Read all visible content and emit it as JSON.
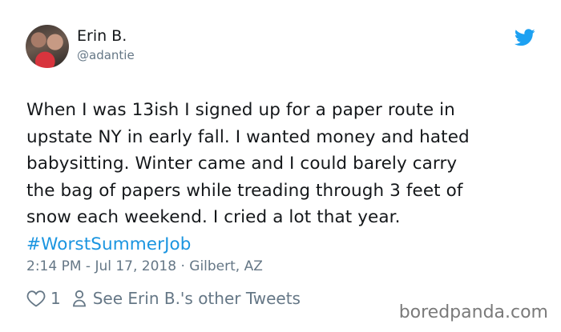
{
  "user": {
    "name": "Erin B.",
    "handle": "@adantie"
  },
  "tweet": {
    "line1": "When I was 13ish I signed up for a paper route in",
    "line2": "upstate NY in early fall. I wanted money and hated",
    "line3": "babysitting. Winter came and I could barely carry",
    "line4": "the bag of papers while treading through 3 feet of",
    "line5": "snow each weekend. I cried a lot that year.",
    "hashtag": "#WorstSummerJob",
    "meta": "2:14 PM - Jul 17, 2018 · Gilbert, AZ"
  },
  "actions": {
    "like_count": "1",
    "other_tweets_link": "See Erin B.'s other Tweets"
  },
  "icons": {
    "brand": "twitter-bird-icon",
    "like": "heart-icon",
    "profile": "person-icon"
  },
  "colors": {
    "twitter_blue": "#1da1f2",
    "hashtag": "#1b95e0",
    "secondary_text": "#657786"
  },
  "watermark": "boredpanda.com"
}
